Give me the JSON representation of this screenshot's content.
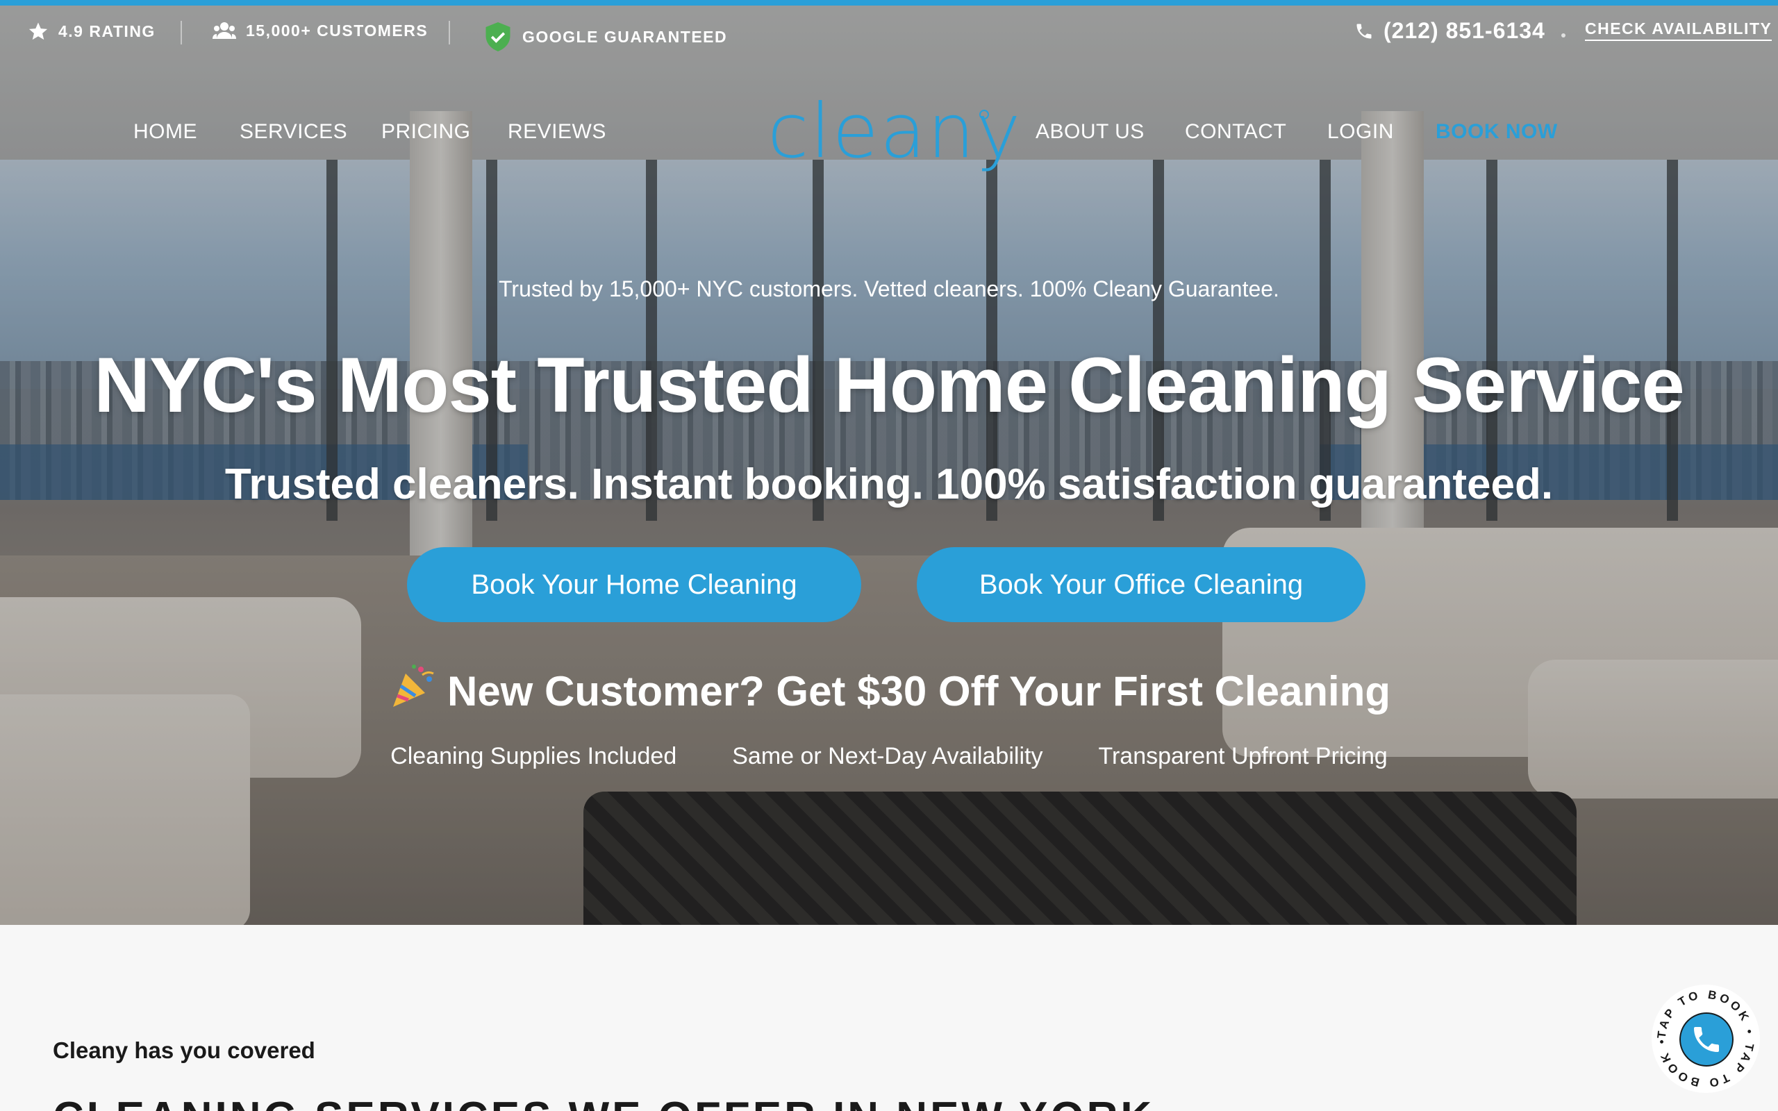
{
  "colors": {
    "accent": "#2a9fd8",
    "text_dark": "#1a1a1a",
    "white": "#ffffff"
  },
  "topbar": {
    "rating": {
      "icon": "star-icon",
      "label": "4.9 RATING"
    },
    "customers": {
      "icon": "users-icon",
      "label": "15,000+ CUSTOMERS"
    },
    "guarantee": {
      "icon": "shield-check-icon",
      "label": "GOOGLE GUARANTEED"
    },
    "phone": {
      "icon": "phone-icon",
      "label": "(212) 851-6134"
    },
    "check_availability": "CHECK AVAILABILITY"
  },
  "nav": {
    "left": [
      "HOME",
      "SERVICES",
      "PRICING",
      "REVIEWS"
    ],
    "logo": "cleany",
    "right": [
      "ABOUT US",
      "CONTACT",
      "LOGIN"
    ],
    "book_now": "BOOK NOW"
  },
  "hero": {
    "tagline": "Trusted by 15,000+ NYC customers. Vetted cleaners. 100% Cleany Guarantee.",
    "headline": "NYC's Most Trusted Home Cleaning Service",
    "subhead": "Trusted cleaners. Instant booking. 100% satisfaction guaranteed.",
    "cta_home": "Book Your Home Cleaning",
    "cta_office": "Book Your Office Cleaning",
    "promo_icon": "party-popper-icon",
    "promo": "New Customer? Get $30 Off Your First Cleaning",
    "features": [
      "Cleaning Supplies Included",
      "Same or Next-Day Availability",
      "Transparent Upfront Pricing"
    ]
  },
  "section": {
    "covered": "Cleany has you covered",
    "heading": "CLEANING SERVICES WE OFFER IN NEW YORK"
  },
  "badge": {
    "text": "TAP TO BOOK • TAP TO BOOK • ",
    "icon": "phone-icon"
  }
}
